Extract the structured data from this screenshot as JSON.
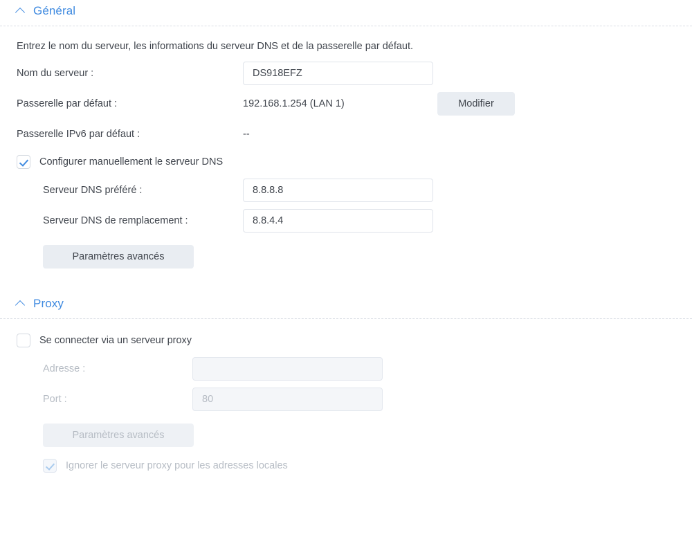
{
  "sections": {
    "general": {
      "title": "Général",
      "chevron_icon": "chevron-up-icon",
      "expanded": true,
      "description": "Entrez le nom du serveur, les informations du serveur DNS et de la passerelle par défaut.",
      "fields": {
        "server_name": {
          "label": "Nom du serveur :",
          "value": "DS918EFZ",
          "placeholder": ""
        },
        "default_gateway": {
          "label": "Passerelle par défaut :",
          "value": "192.168.1.254 (LAN 1)",
          "button_label": "Modifier"
        },
        "default_gateway_ipv6": {
          "label": "Passerelle IPv6 par défaut :",
          "value": "--"
        },
        "manual_dns": {
          "label": "Configurer manuellement le serveur DNS",
          "checked": true,
          "enabled": true
        },
        "dns_preferred": {
          "label": "Serveur DNS préféré :",
          "value": "8.8.8.8",
          "placeholder": ""
        },
        "dns_alternate": {
          "label": "Serveur DNS de remplacement :",
          "value": "8.8.4.4",
          "placeholder": ""
        }
      },
      "advanced_button": {
        "label": "Paramètres avancés",
        "enabled": true
      }
    },
    "proxy": {
      "title": "Proxy",
      "chevron_icon": "chevron-up-icon",
      "expanded": true,
      "fields": {
        "use_proxy": {
          "label": "Se connecter via un serveur proxy",
          "checked": false,
          "enabled": true
        },
        "address": {
          "label": "Adresse :",
          "value": "",
          "placeholder": "",
          "enabled": false
        },
        "port": {
          "label": "Port :",
          "value": "",
          "placeholder": "80",
          "enabled": false
        },
        "bypass_local": {
          "label": "Ignorer le serveur proxy pour les adresses locales",
          "checked": true,
          "enabled": false
        }
      },
      "advanced_button": {
        "label": "Paramètres avancés",
        "enabled": false
      }
    }
  },
  "colors": {
    "accent": "#3f8ae0",
    "text": "#40454d",
    "muted": "#b6bcc4",
    "button_bg": "#e9edf2",
    "input_border": "#dfe3ea",
    "divider": "#d9dde4"
  }
}
